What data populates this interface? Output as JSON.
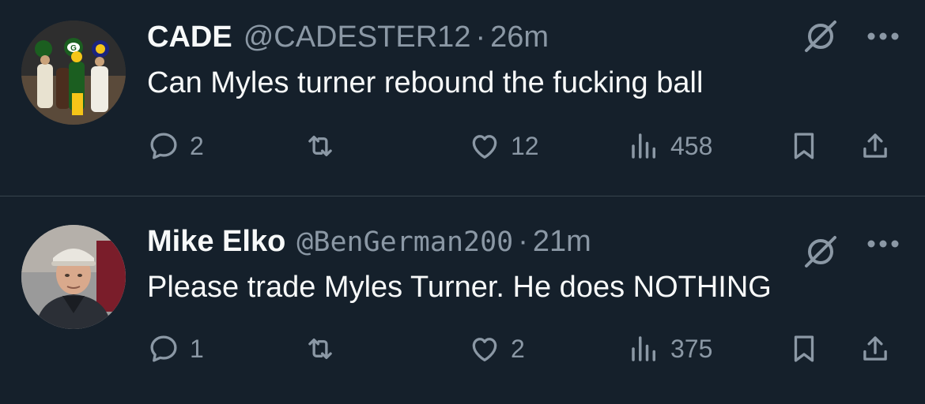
{
  "tweets": [
    {
      "display_name": "CADE",
      "handle": "@CADESTER12",
      "separator": "·",
      "time": "26m",
      "text": "Can Myles turner rebound the fucking ball",
      "replies": "2",
      "likes": "12",
      "views": "458",
      "avatar_icon": "sports-collage-avatar"
    },
    {
      "display_name": "Mike Elko",
      "handle": "@BenGerman200",
      "separator": "·",
      "time": "21m",
      "text": "Please trade Myles Turner. He does NOTHING",
      "replies": "1",
      "likes": "2",
      "views": "375",
      "avatar_icon": "coach-photo-avatar"
    }
  ],
  "colors": {
    "background": "#15202b",
    "primary_text": "#f7f9f9",
    "secondary_text": "#8b98a5",
    "divider": "#38444d"
  }
}
